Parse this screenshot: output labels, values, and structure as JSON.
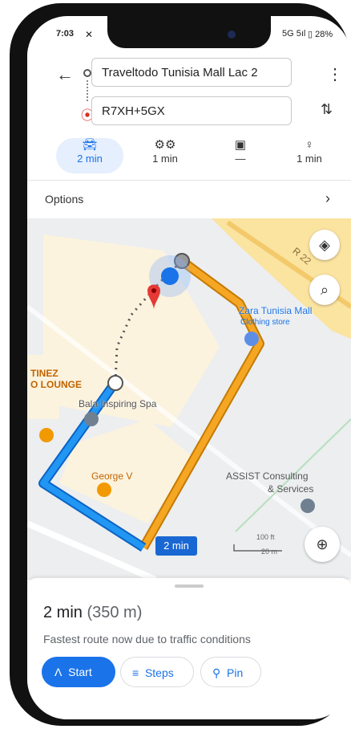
{
  "status": {
    "time": "7:03",
    "network": "5G",
    "signal": "5ıl",
    "battery": "28%"
  },
  "route": {
    "origin": "Traveltodo Tunisia Mall Lac 2",
    "destination": "R7XH+5GX"
  },
  "modes": [
    {
      "name": "car",
      "icon": "car-icon",
      "time": "2 min"
    },
    {
      "name": "motorcycle",
      "icon": "motorcycle-icon",
      "time": "1 min"
    },
    {
      "name": "transit",
      "icon": "transit-icon",
      "time": "—"
    },
    {
      "name": "walk",
      "icon": "walk-icon",
      "time": "1 min"
    }
  ],
  "options_label": "Options",
  "map": {
    "labels": {
      "road": "R 22",
      "zara": "Zara Tunisia Mall",
      "zara_sub": "Clothing store",
      "martinez1": "TINEZ",
      "martinez2": "O LOUNGE",
      "bala": "Bala Inspiring Spa",
      "george": "George V",
      "assist1": "ASSIST Consulting",
      "assist2": "& Services",
      "scale_ft": "100 ft",
      "scale_m": "20 m",
      "route_time": "2 min"
    },
    "colors": {
      "route_blue": "#2196f3",
      "route_orange": "#f5a623",
      "pin_red": "#e53935"
    }
  },
  "summary": {
    "time": "2 min",
    "distance": "(350 m)",
    "note": "Fastest route now due to traffic conditions"
  },
  "actions": {
    "start": "Start",
    "steps": "Steps",
    "pin": "Pin"
  },
  "colors": {
    "accent": "#1a73e8"
  }
}
